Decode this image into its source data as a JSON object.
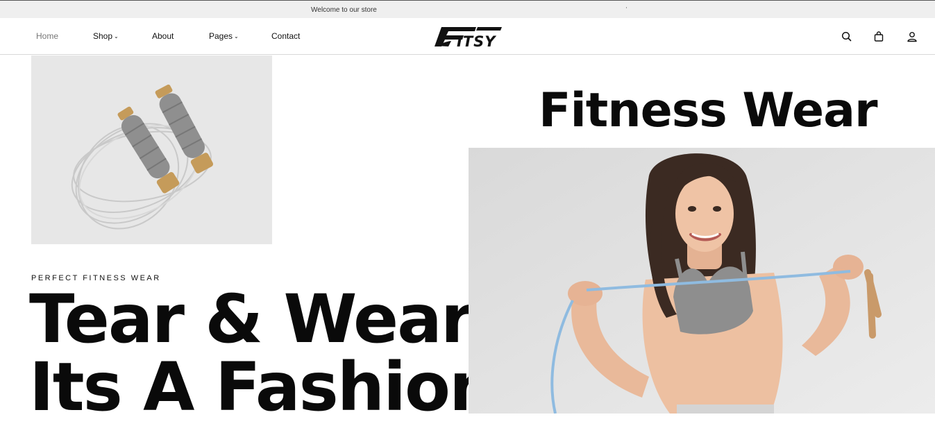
{
  "topbar": {
    "welcome_text": "Welcome to our store"
  },
  "nav": {
    "items": [
      {
        "label": "Home",
        "active": true,
        "dropdown": false
      },
      {
        "label": "Shop",
        "active": false,
        "dropdown": true
      },
      {
        "label": "About",
        "active": false,
        "dropdown": false
      },
      {
        "label": "Pages",
        "active": false,
        "dropdown": true
      },
      {
        "label": "Contact",
        "active": false,
        "dropdown": false
      }
    ]
  },
  "brand": {
    "logo_text": "FITSY"
  },
  "header_icons": [
    "search-icon",
    "cart-icon",
    "account-icon"
  ],
  "hero": {
    "kicker": "PERFECT FITNESS WEAR",
    "line1": "Tear & Wear",
    "line2": "Its A Fashion",
    "side_title": "Fitness Wear"
  },
  "colors": {
    "topbar_bg": "#efefef",
    "text": "#111111",
    "nav_active": "#777777",
    "image_bg": "#e7e7e7"
  }
}
